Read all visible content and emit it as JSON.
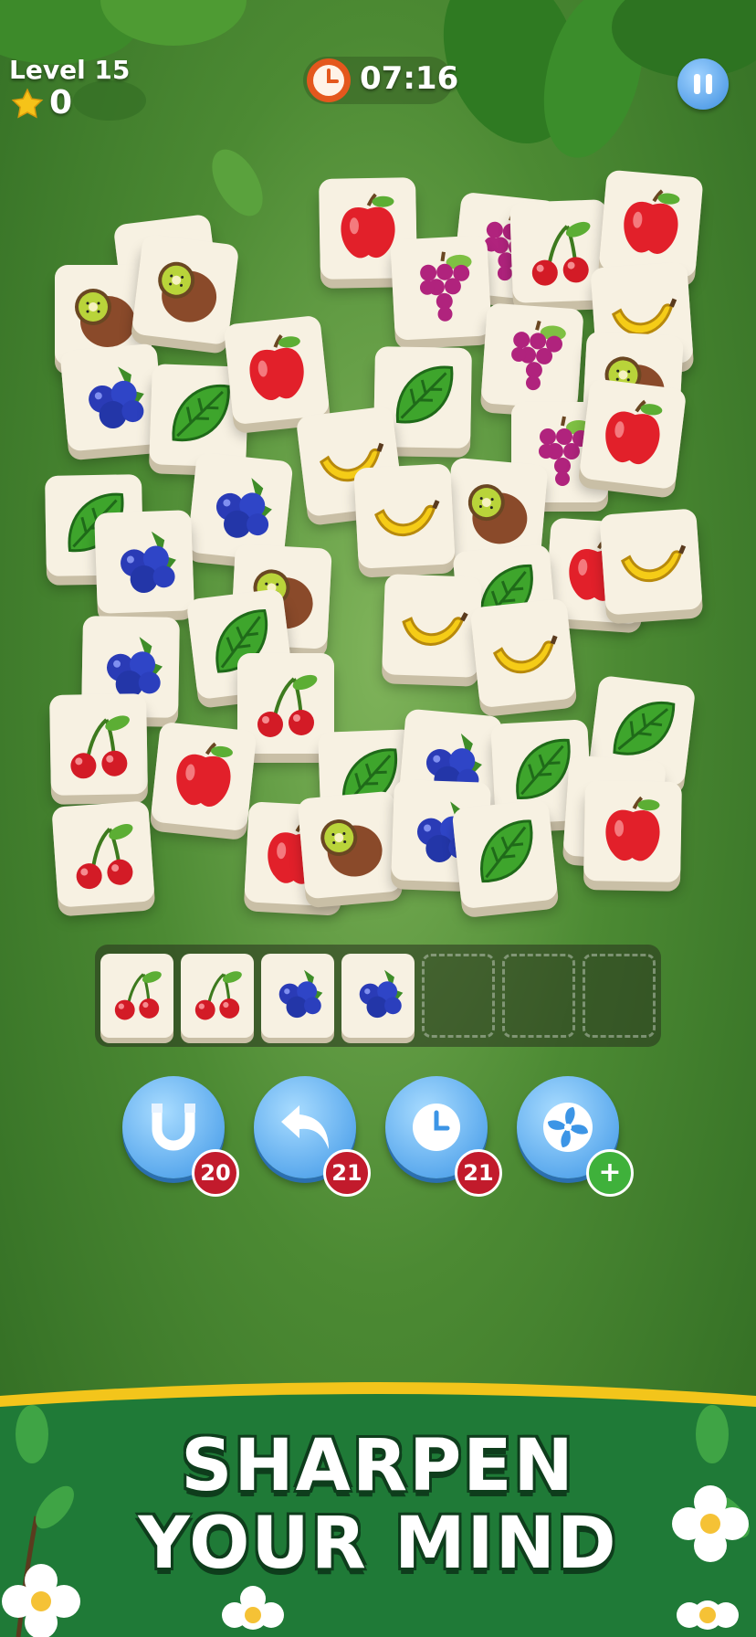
{
  "hud": {
    "level_label": "Level 15",
    "stars": "0",
    "timer": "07:16",
    "pause_icon": "pause-icon",
    "star_icon": "star-icon",
    "clock_icon": "clock-icon"
  },
  "board": {
    "tiles": [
      "cherry",
      "cherry",
      "blueberry",
      "blueberry",
      "apple",
      "apple",
      "grape",
      "grape",
      "kiwi",
      "kiwi",
      "leaf",
      "leaf",
      "banana",
      "banana"
    ]
  },
  "tray": {
    "slots": [
      "cherry",
      "cherry",
      "blueberry",
      "blueberry",
      "empty",
      "empty",
      "empty"
    ]
  },
  "tools": [
    {
      "name": "magnet",
      "icon": "magnet-icon",
      "count": "20"
    },
    {
      "name": "undo",
      "icon": "undo-icon",
      "count": "21"
    },
    {
      "name": "time",
      "icon": "clock-icon",
      "count": "21"
    },
    {
      "name": "shuffle",
      "icon": "fan-icon",
      "count": "+"
    }
  ],
  "banner": {
    "line1": "SHARPEN",
    "line2": "YOUR MIND"
  },
  "colors": {
    "tile_face": "#f7f1e2",
    "tool_blue": "#3c95e6",
    "badge_red": "#c21b2c",
    "badge_green": "#3fb13b",
    "banner_green": "#1f7a37",
    "banner_gold": "#f3c51b"
  }
}
